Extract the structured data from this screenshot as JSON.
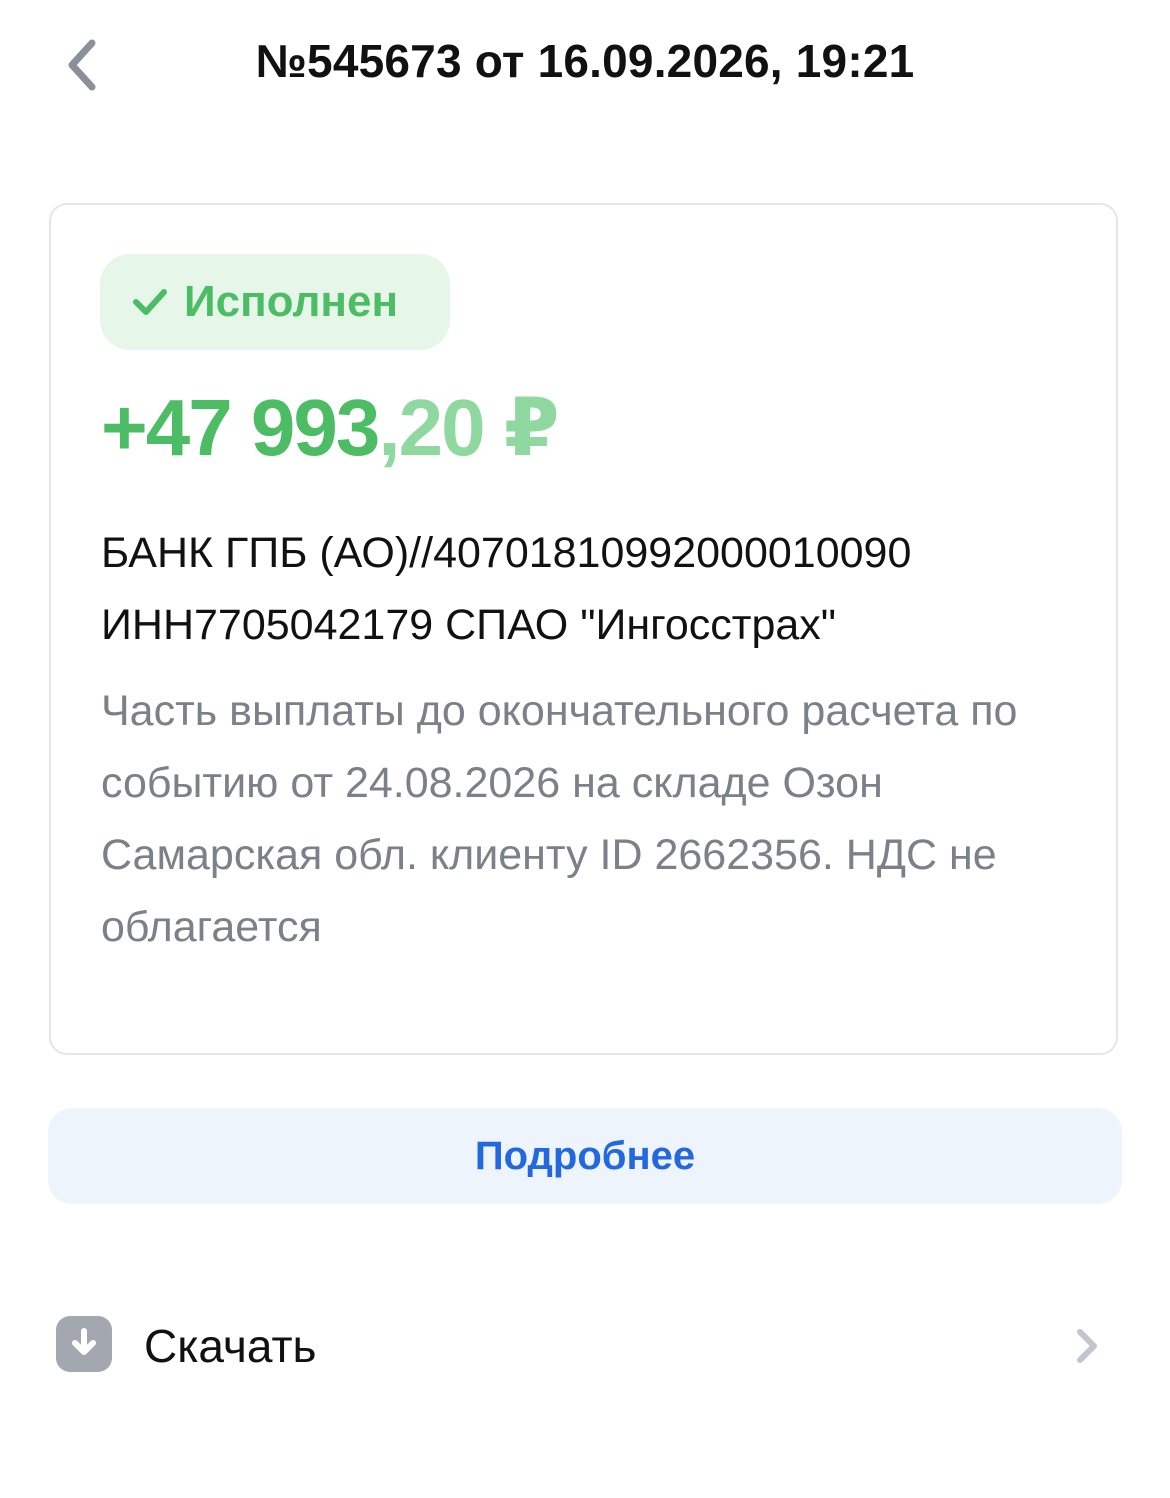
{
  "header": {
    "title": "№545673 от 16.09.2026, 19:21",
    "back_icon": "chevron-left-icon"
  },
  "card": {
    "status": {
      "label": "Исполнен",
      "icon": "check-icon",
      "color": "#4cbd64",
      "background": "#e6f7ea"
    },
    "amount": {
      "integer": "+47 993",
      "fraction": ",20",
      "currency": "₽"
    },
    "counterparty": {
      "line1": "БАНК ГПБ (АО)//40701810992000010090",
      "line2": "ИНН7705042179 СПАО \"Ингосстрах\""
    },
    "purpose": "Часть выплаты до окончательного расчета по событию от 24.08.2026 на складе Озон Самарская обл. клиенту ID 2662356. НДС не облагается"
  },
  "details_button": {
    "label": "Подробнее",
    "color": "#2468e0"
  },
  "download": {
    "label": "Скачать",
    "icon": "download-icon",
    "chevron": "chevron-right-icon"
  }
}
